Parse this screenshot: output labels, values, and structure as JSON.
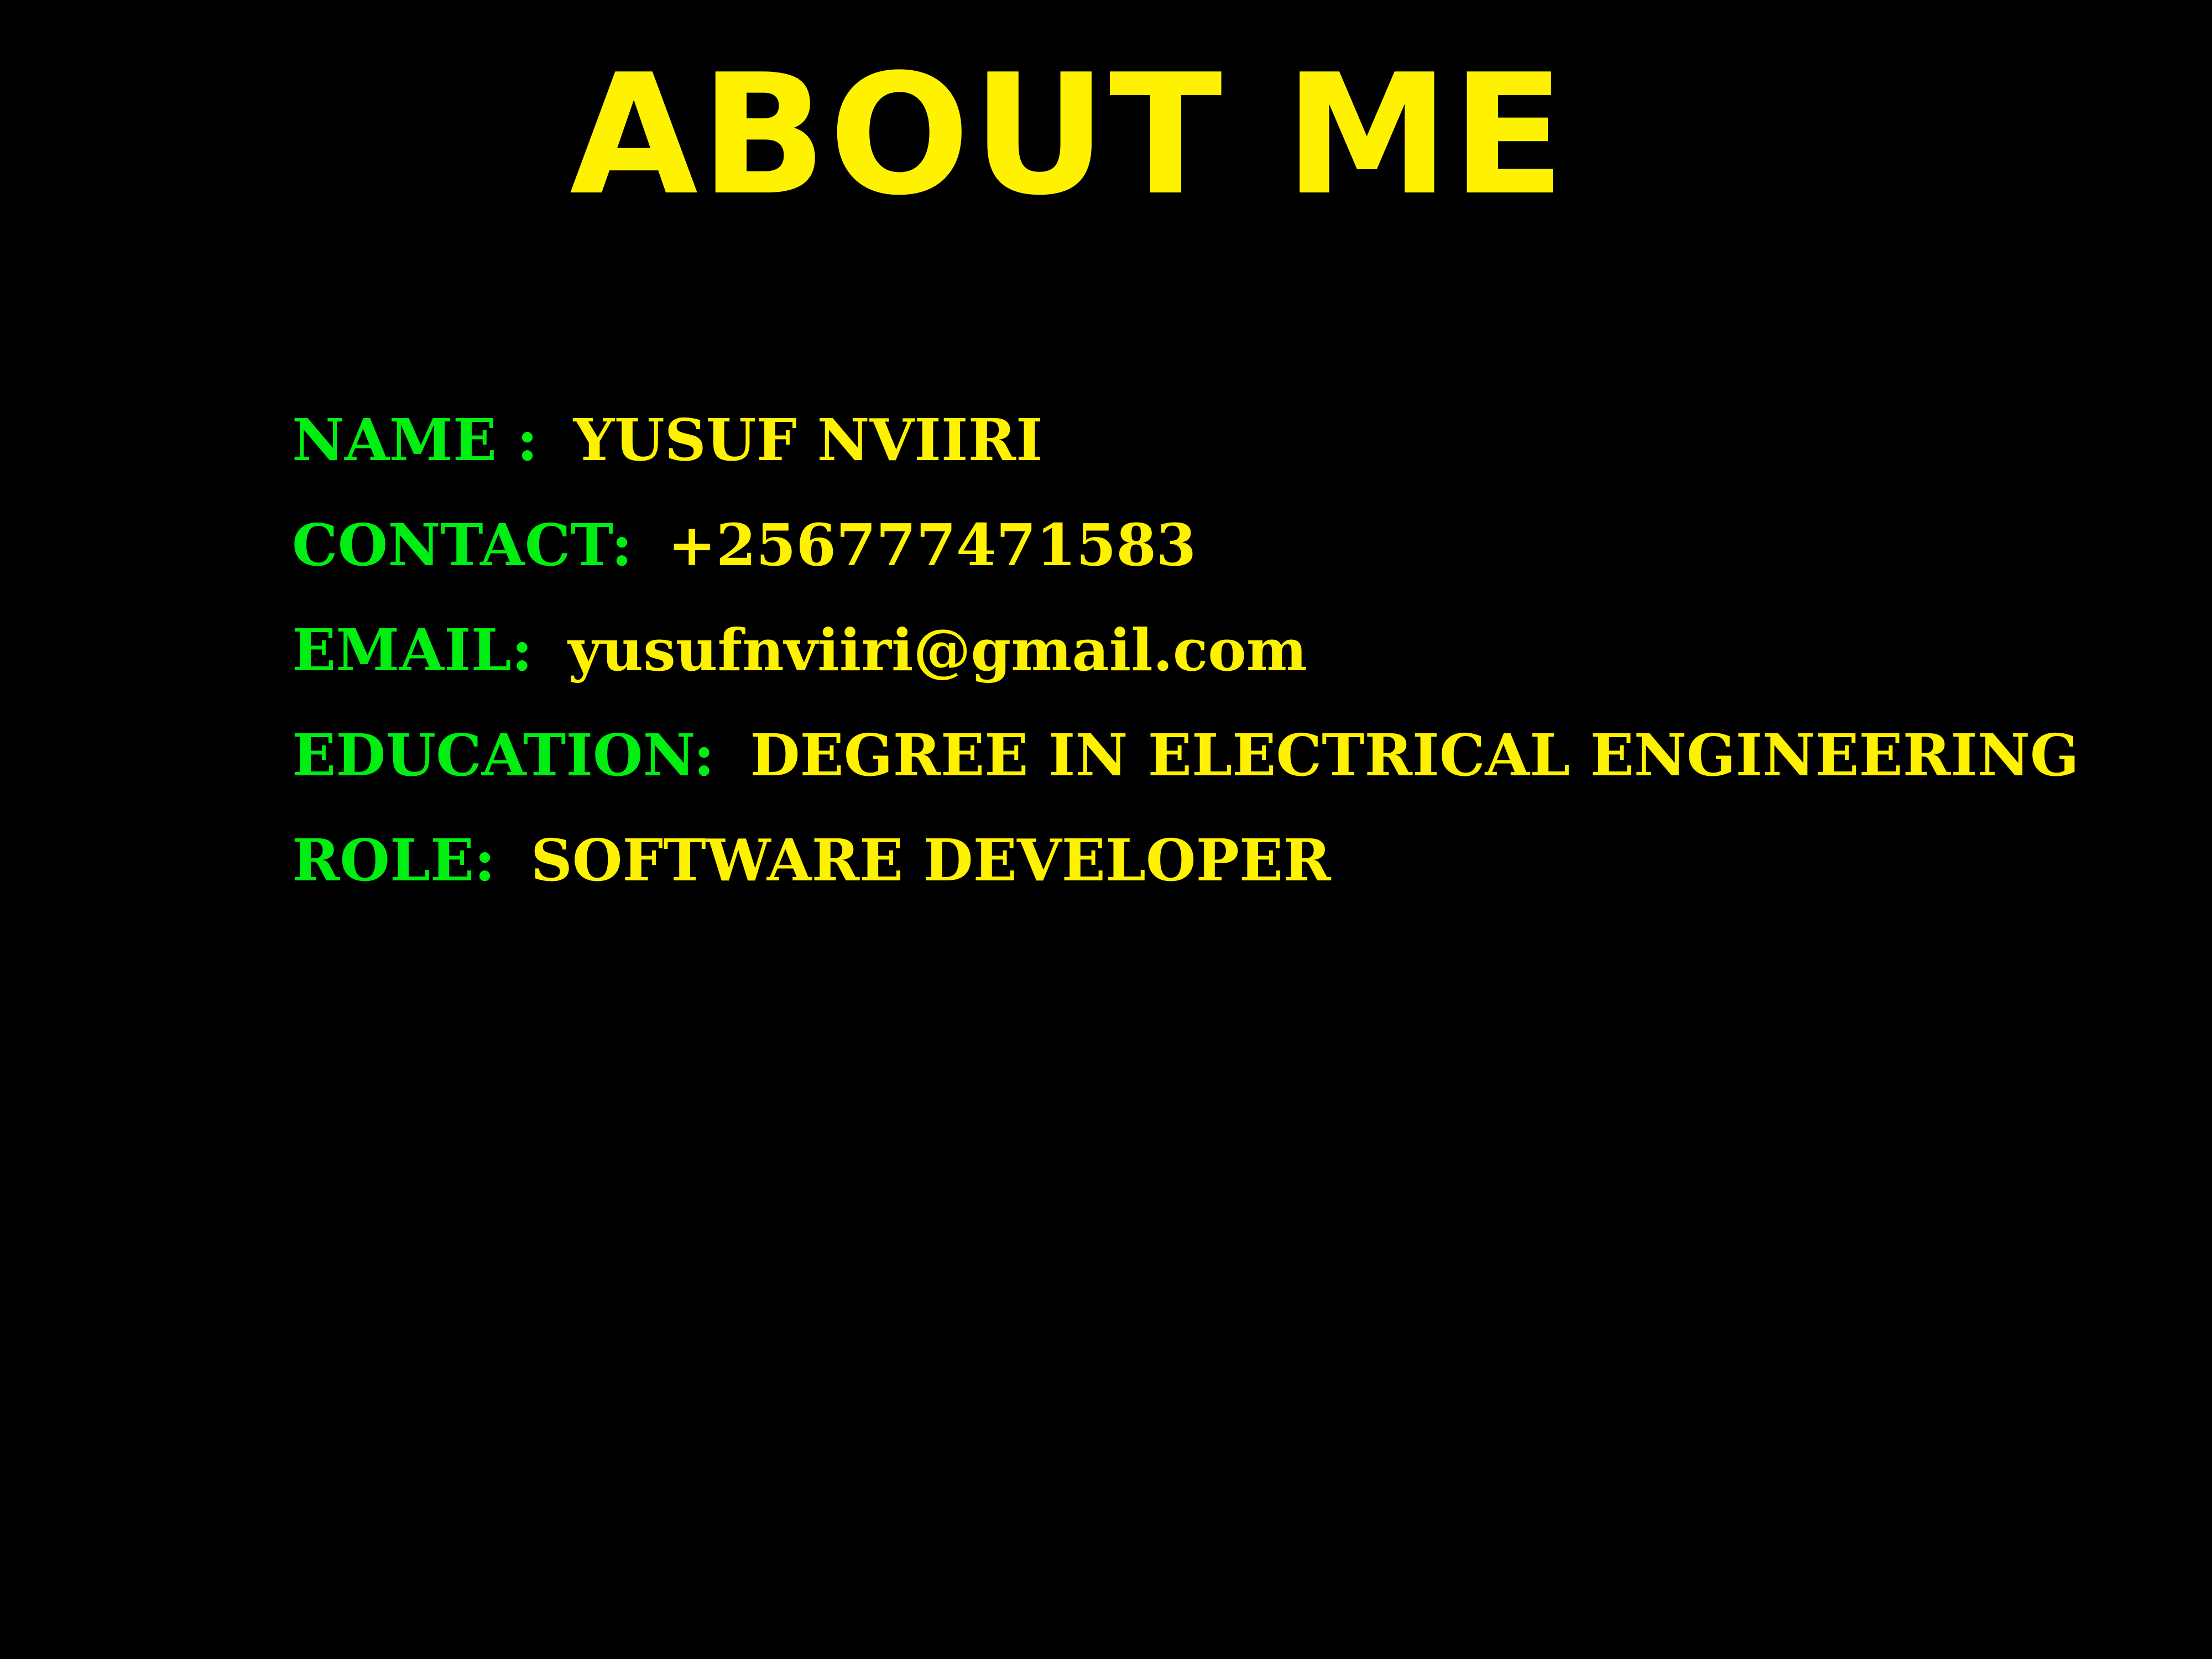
{
  "title": "ABOUT ME",
  "colors": {
    "background": "#000000",
    "title": "#fff200",
    "label": "#00ee11",
    "value": "#fff200"
  },
  "details": [
    {
      "label": "NAME :",
      "value": "YUSUF NVIIRI"
    },
    {
      "label": "CONTACT:",
      "value": "+256777471583"
    },
    {
      "label": "EMAIL:",
      "value": "yusufnviiri@gmail.com"
    },
    {
      "label": "EDUCATION:",
      "value": "DEGREE IN ELECTRICAL ENGINEERING"
    },
    {
      "label": "ROLE:",
      "value": "SOFTWARE DEVELOPER"
    }
  ]
}
